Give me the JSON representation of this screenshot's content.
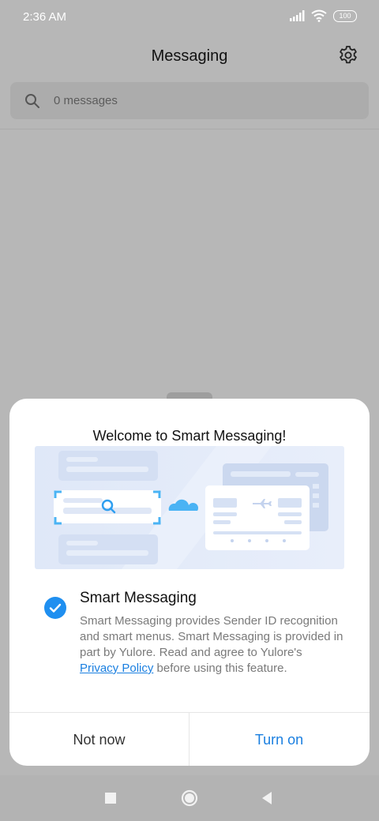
{
  "status_bar": {
    "time": "2:36 AM",
    "battery": "100",
    "icons": [
      "signal-icon",
      "wifi-icon",
      "battery-icon"
    ]
  },
  "header": {
    "title": "Messaging",
    "settings_icon": "gear-icon"
  },
  "search": {
    "placeholder": "0 messages",
    "icon": "search-icon"
  },
  "dialog": {
    "title": "Welcome to Smart Messaging!",
    "option": {
      "checked": true,
      "title": "Smart Messaging",
      "description": "Smart Messaging provides Sender ID recognition and smart menus. Smart Messaging is provided in part by Yulore. Read and agree to Yulore's",
      "link_text": "Privacy Policy",
      "description_end": "before using this feature."
    },
    "buttons": {
      "secondary": "Not now",
      "primary": "Turn on"
    }
  },
  "nav_bar": {
    "icons": [
      "recents-icon",
      "home-icon",
      "back-icon"
    ]
  },
  "colors": {
    "accent": "#1f8ff0",
    "link": "#1a7fe0",
    "scrim": "#b7b7b7"
  }
}
